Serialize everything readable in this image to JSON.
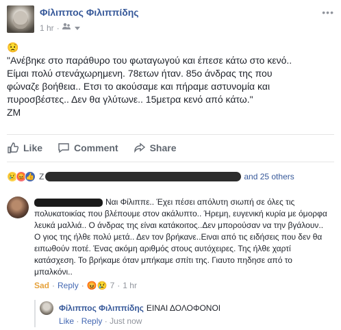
{
  "post": {
    "author": "Φίλιππος Φιλιππίδης",
    "time": "1 hr",
    "menu": "•••",
    "emoji": "😟",
    "lines": [
      "\"Ανέβηκε στο παράθυρο του φωταγωγού και έπεσε κάτω στο κενό..",
      "Είμαι πολύ στενάχωρημενη. 78ετων ήταν. 85ο άνδρας της που",
      "φώναζε βοήθεια.. Ετσι το ακούσαμε και πήραμε αστυνομία και",
      "πυροσβέστες.. Δεν θα γλύτωνε.. 15μετρα κενό από κάτω.\"",
      "ΖΜ"
    ]
  },
  "actions": {
    "like": "Like",
    "comment": "Comment",
    "share": "Share"
  },
  "reactions": {
    "icons": [
      "😢",
      "😡",
      "👍"
    ],
    "text_fragment_start": "Ζ",
    "others_text": "and 25 others"
  },
  "comment": {
    "text": "Ναι Φίλιππε.. Έχει πέσει απόλυτη σιωπή σε όλες τις πολυκατοικίας που βλέπουμε στον ακάλυπτο.. Ήρεμη, ευγενική κυρία με όμορφα λευκά μαλλιά.. Ο άνδρας της είναι κατάκοιτος..Δεν μπορούσαν να την βγάλουν.. Ο γιος της ήλθε πολύ μετά.. Δεν τον βρήκανε..Ειναι από τις ειδήσεις που δεν θα ειπωθούν ποτέ. Ένας ακόμη αριθμός στους αυτόχειρες. Της ήλθε χαρτί κατάσχεση. Το βρήκαμε όταν μπήκαμε σπίτι της. Γιαυτο πηδησε από το μπαλκόνι..",
    "reaction_label": "Sad",
    "reply_label": "Reply",
    "reaction_icons": "😡😢",
    "reaction_count": "7",
    "time": "1 hr"
  },
  "reply": {
    "author": "Φίλιππος Φιλιππίδης",
    "text": "ΕΙΝΑΙ ΔΟΛΟΦΟΝΟΙ",
    "like_label": "Like",
    "reply_label": "Reply",
    "time": "Just now"
  },
  "colors": {
    "link": "#365899",
    "meta": "#90949c",
    "text": "#1d2129"
  }
}
